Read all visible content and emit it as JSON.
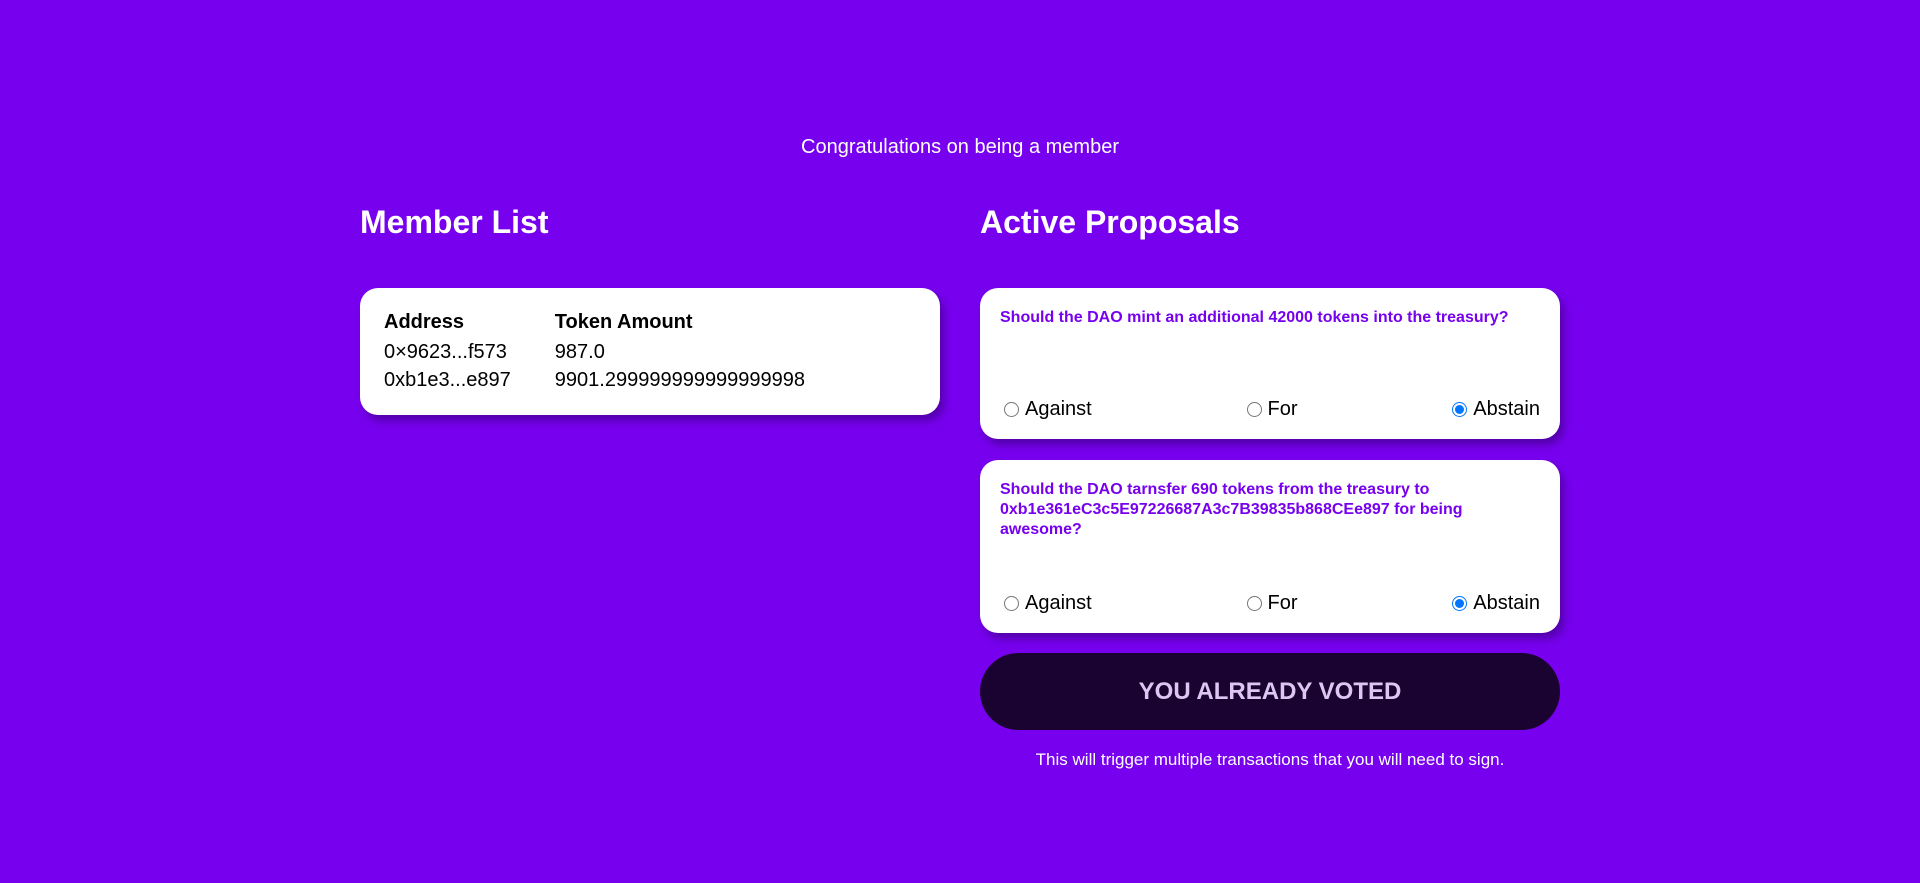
{
  "header": {
    "congrats": "Congratulations on being a member"
  },
  "member_list": {
    "title": "Member List",
    "columns": [
      "Address",
      "Token Amount"
    ],
    "rows": [
      {
        "address": "0×9623...f573",
        "amount": "987.0"
      },
      {
        "address": "0xb1e3...e897",
        "amount": "9901.299999999999999998"
      }
    ]
  },
  "proposals": {
    "title": "Active Proposals",
    "items": [
      {
        "question": "Should the DAO mint an additional 42000 tokens into the treasury?",
        "options": [
          "Against",
          "For",
          "Abstain"
        ],
        "selected": "Abstain"
      },
      {
        "question": "Should the DAO tarnsfer 690 tokens from the treasury to 0xb1e361eC3c5E97226687A3c7B39835b868CEe897 for being awesome?",
        "options": [
          "Against",
          "For",
          "Abstain"
        ],
        "selected": "Abstain"
      }
    ],
    "submit_label": "YOU ALREADY VOTED",
    "hint": "This will trigger multiple transactions that you will need to sign."
  },
  "colors": {
    "background": "#7700ee",
    "accent": "#7700ee",
    "button": "#1a0330",
    "button_text": "#dcc7f2"
  }
}
